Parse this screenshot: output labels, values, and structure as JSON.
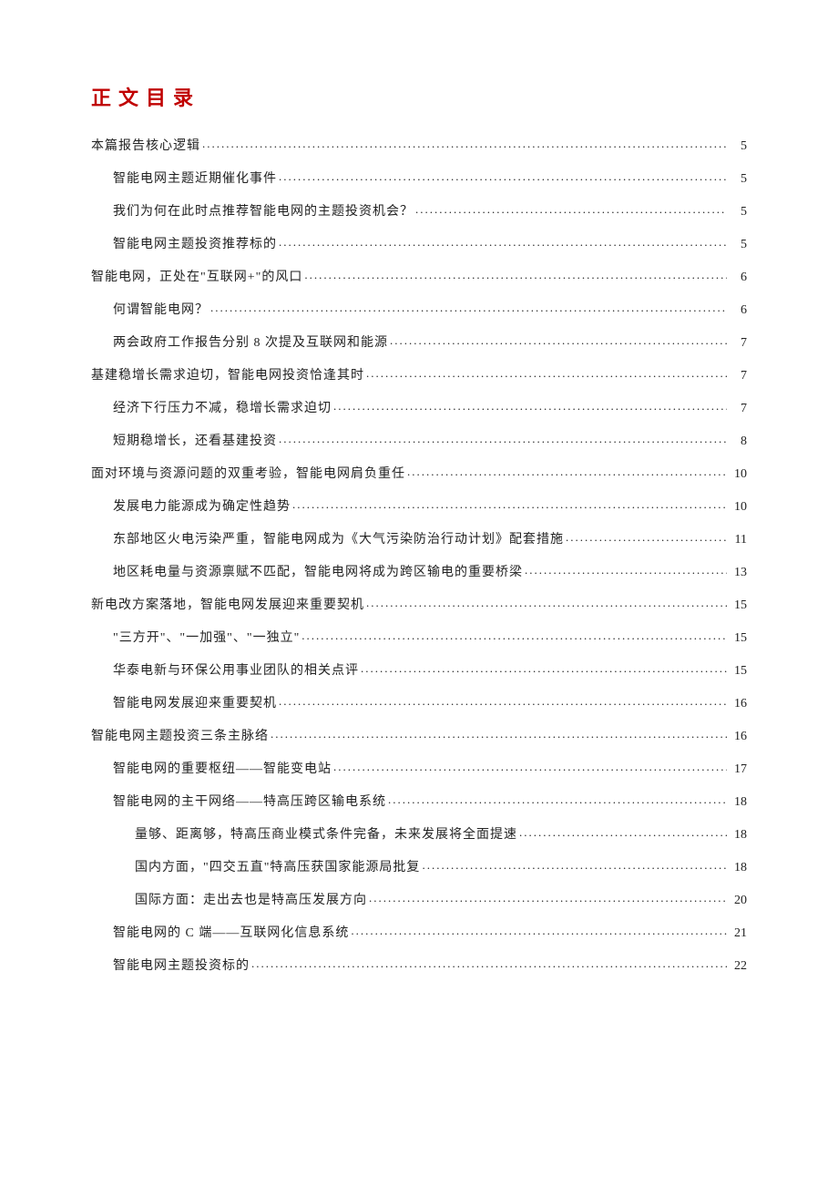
{
  "title": "正文目录",
  "toc": [
    {
      "level": 0,
      "label": "本篇报告核心逻辑",
      "page": "5"
    },
    {
      "level": 1,
      "label": "智能电网主题近期催化事件",
      "page": "5"
    },
    {
      "level": 1,
      "label": "我们为何在此时点推荐智能电网的主题投资机会？",
      "page": "5"
    },
    {
      "level": 1,
      "label": "智能电网主题投资推荐标的",
      "page": "5"
    },
    {
      "level": 0,
      "label": "智能电网，正处在\"互联网+\"的风口",
      "page": "6"
    },
    {
      "level": 1,
      "label": "何谓智能电网？",
      "page": "6"
    },
    {
      "level": 1,
      "label": "两会政府工作报告分别 8 次提及互联网和能源",
      "page": "7"
    },
    {
      "level": 0,
      "label": "基建稳增长需求迫切，智能电网投资恰逢其时",
      "page": "7"
    },
    {
      "level": 1,
      "label": "经济下行压力不减，稳增长需求迫切",
      "page": "7"
    },
    {
      "level": 1,
      "label": "短期稳增长，还看基建投资",
      "page": "8"
    },
    {
      "level": 0,
      "label": "面对环境与资源问题的双重考验，智能电网肩负重任",
      "page": "10"
    },
    {
      "level": 1,
      "label": "发展电力能源成为确定性趋势",
      "page": "10"
    },
    {
      "level": 1,
      "label": "东部地区火电污染严重，智能电网成为《大气污染防治行动计划》配套措施",
      "page": "11"
    },
    {
      "level": 1,
      "label": "地区耗电量与资源禀赋不匹配，智能电网将成为跨区输电的重要桥梁",
      "page": "13"
    },
    {
      "level": 0,
      "label": "新电改方案落地，智能电网发展迎来重要契机",
      "page": "15"
    },
    {
      "level": 1,
      "label": "\"三方开\"、\"一加强\"、\"一独立\"",
      "page": "15"
    },
    {
      "level": 1,
      "label": "华泰电新与环保公用事业团队的相关点评",
      "page": "15"
    },
    {
      "level": 1,
      "label": "智能电网发展迎来重要契机",
      "page": "16"
    },
    {
      "level": 0,
      "label": "智能电网主题投资三条主脉络",
      "page": "16"
    },
    {
      "level": 1,
      "label": "智能电网的重要枢纽——智能变电站",
      "page": "17"
    },
    {
      "level": 1,
      "label": "智能电网的主干网络——特高压跨区输电系统",
      "page": "18"
    },
    {
      "level": 2,
      "label": "量够、距离够，特高压商业模式条件完备，未来发展将全面提速",
      "page": "18"
    },
    {
      "level": 2,
      "label": "国内方面，\"四交五直\"特高压获国家能源局批复",
      "page": "18"
    },
    {
      "level": 2,
      "label": "国际方面：走出去也是特高压发展方向",
      "page": "20"
    },
    {
      "level": 1,
      "label": "智能电网的 C 端——互联网化信息系统",
      "page": "21"
    },
    {
      "level": 1,
      "label": "智能电网主题投资标的",
      "page": "22"
    }
  ]
}
